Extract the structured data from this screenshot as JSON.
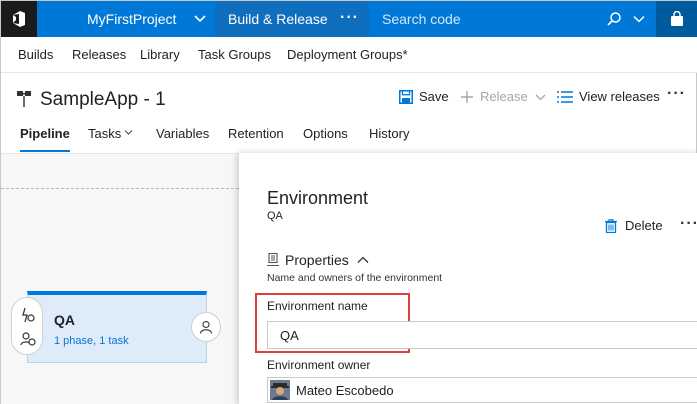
{
  "topbar": {
    "logo_icon": "vsts-logo-icon",
    "project_name": "MyFirstProject",
    "hub_label": "Build & Release",
    "hub_more": "···",
    "search_placeholder": "Search code"
  },
  "subnav": {
    "items": [
      "Builds",
      "Releases",
      "Library",
      "Task Groups",
      "Deployment Groups*"
    ]
  },
  "header": {
    "title": "SampleApp - 1",
    "save_label": "Save",
    "release_label": "Release",
    "view_releases_label": "View releases",
    "more": "···"
  },
  "tabs": [
    "Pipeline",
    "Tasks",
    "Variables",
    "Retention",
    "Options",
    "History"
  ],
  "active_tab": "Pipeline",
  "pipeline": {
    "environment_name": "QA",
    "environment_summary": "1 phase, 1 task"
  },
  "panel": {
    "title": "Environment",
    "subtitle": "QA",
    "delete_label": "Delete",
    "more": "···",
    "properties_heading": "Properties",
    "properties_description": "Name and owners of the environment",
    "env_name_label": "Environment name",
    "env_name_value": "QA",
    "owner_label": "Environment owner",
    "owner_name": "Mateo Escobedo"
  },
  "colors": {
    "accent": "#0078d7",
    "hub_bg": "#106ebe",
    "logo_bg": "#1b1b1b",
    "highlight": "#e0403d",
    "card_bg": "#deecf9"
  }
}
